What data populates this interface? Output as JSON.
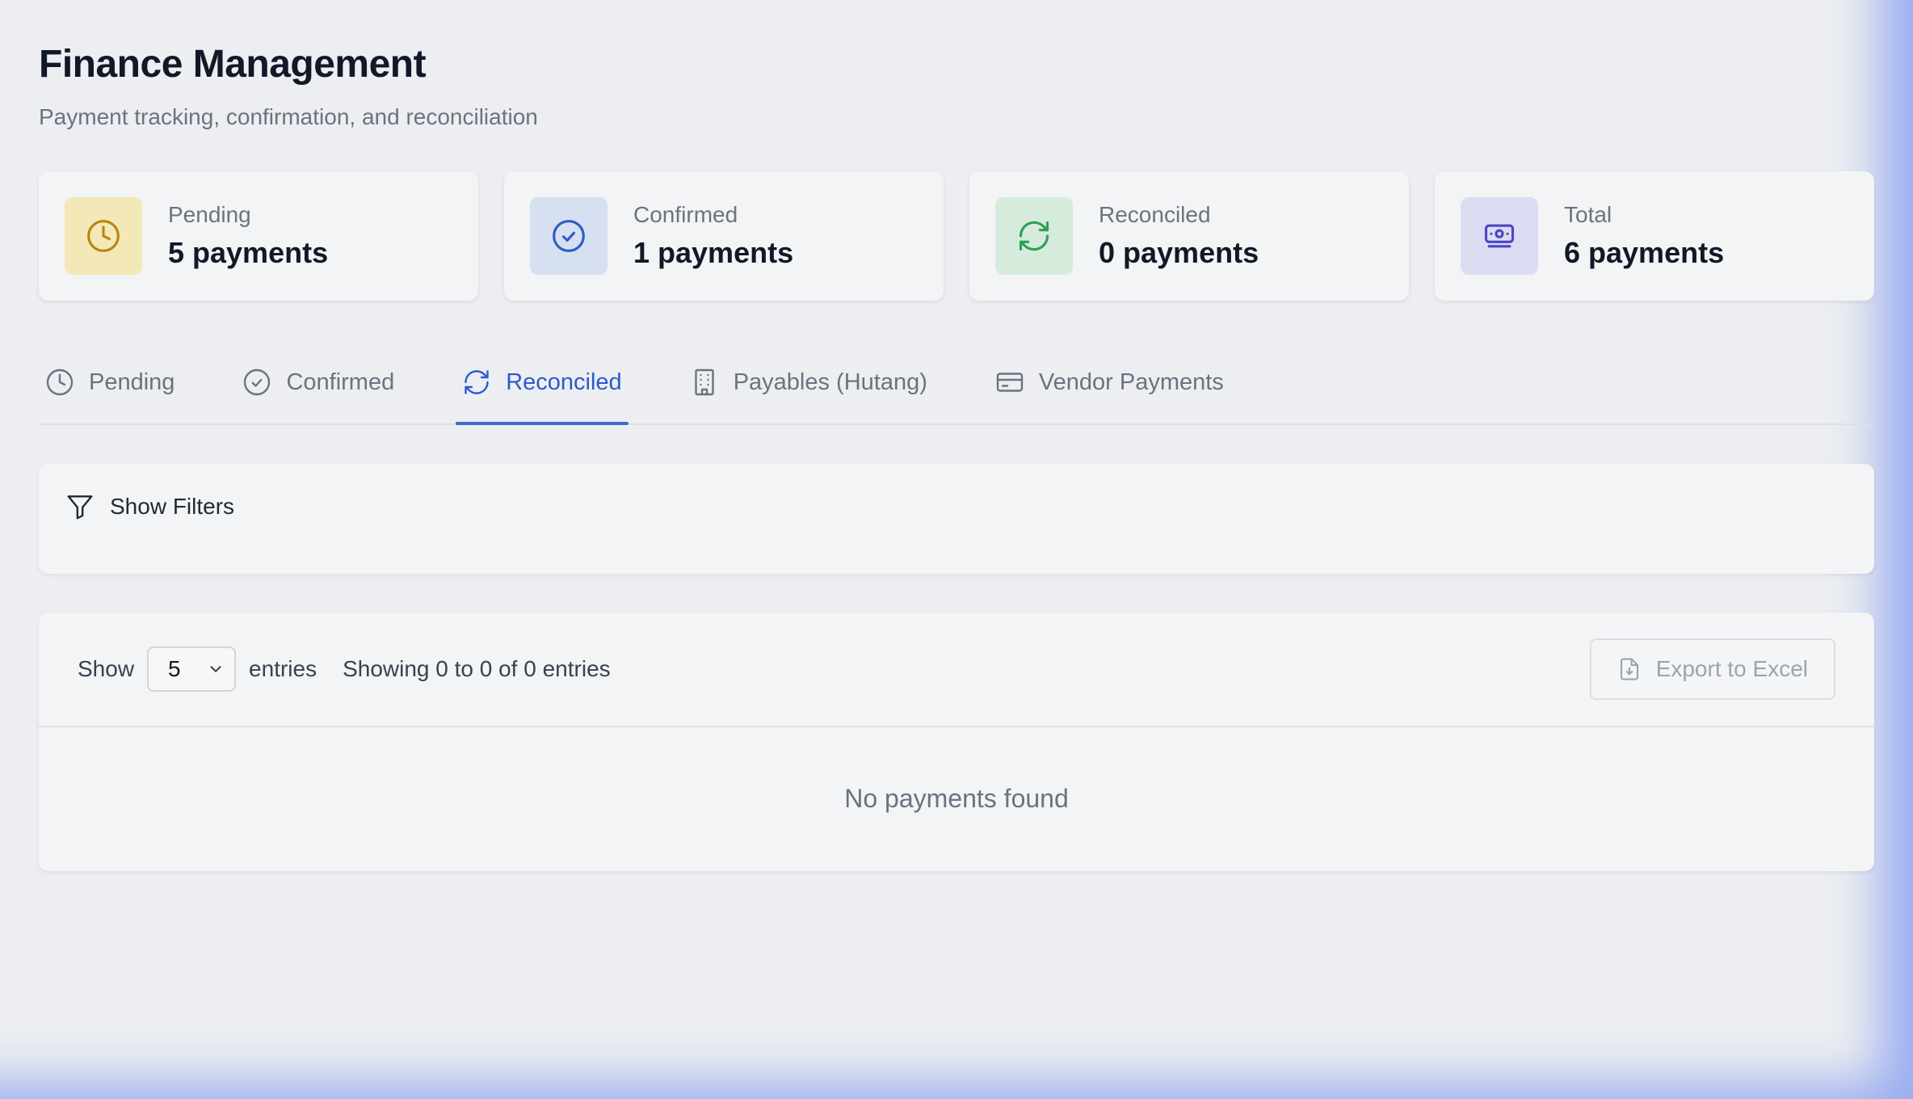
{
  "header": {
    "title": "Finance Management",
    "subtitle": "Payment tracking, confirmation, and reconciliation"
  },
  "stats": [
    {
      "label": "Pending",
      "value": "5 payments",
      "icon": "clock-icon",
      "color": "#b8860b"
    },
    {
      "label": "Confirmed",
      "value": "1 payments",
      "icon": "check-circle-icon",
      "color": "#2d5bcc"
    },
    {
      "label": "Reconciled",
      "value": "0 payments",
      "icon": "refresh-icon",
      "color": "#2f9e55"
    },
    {
      "label": "Total",
      "value": "6 payments",
      "icon": "banknote-icon",
      "color": "#4b46c8"
    }
  ],
  "tabs": [
    {
      "label": "Pending",
      "icon": "clock-icon",
      "active": false
    },
    {
      "label": "Confirmed",
      "icon": "check-circle-icon",
      "active": false
    },
    {
      "label": "Reconciled",
      "icon": "refresh-icon",
      "active": true
    },
    {
      "label": "Payables (Hutang)",
      "icon": "building-icon",
      "active": false
    },
    {
      "label": "Vendor Payments",
      "icon": "credit-card-icon",
      "active": false
    }
  ],
  "filters": {
    "toggle_label": "Show Filters",
    "icon": "filter-icon"
  },
  "table": {
    "show_label": "Show",
    "page_size": "5",
    "entries_label": "entries",
    "showing_info": "Showing 0 to 0 of 0 entries",
    "export_label": "Export to Excel",
    "export_icon": "file-download-icon",
    "empty_message": "No payments found"
  },
  "colors": {
    "accent": "#3b6ad4",
    "background": "#eceef1",
    "card": "#f3f4f5"
  }
}
